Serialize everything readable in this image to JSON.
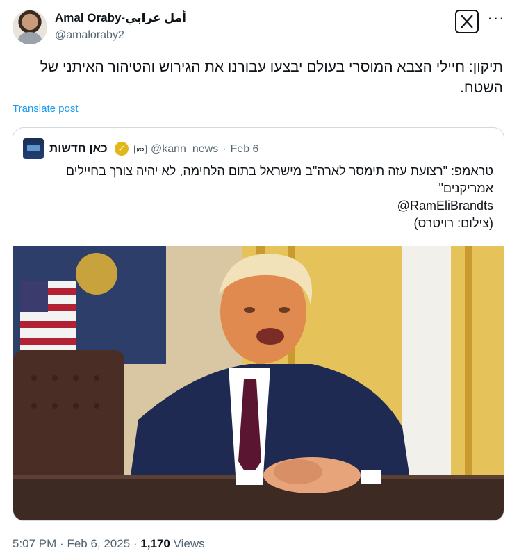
{
  "post": {
    "author": {
      "display_name": "Amal Oraby-أمل عرابي",
      "handle": "@amaloraby2"
    },
    "text": "תיקון: חיילי הצבא המוסרי בעולם יבצעו עבורנו את הגירוש והטיהור האיתני של השטח.",
    "translate_label": "Translate post",
    "time": "5:07 PM",
    "date": "Feb 6, 2025",
    "views_count": "1,170",
    "views_label": "Views"
  },
  "header": {
    "logo_icon": "x-logo-icon",
    "more_icon": "more-icon",
    "more_glyph": "···"
  },
  "quoted": {
    "name": "כאן חדשות",
    "handle": "@kann_news",
    "date": "Feb 6",
    "affiliation_badge": "כאן",
    "verified_color": "#e2b719",
    "lines": [
      "טראמפ: \"רצועת עזה תימסר לארה\"ב מישראל בתום הלחימה, לא יהיה צורך בחיילים אמריקנים\"",
      "@RamEliBrandts",
      "(צילום: רויטרס)"
    ]
  }
}
